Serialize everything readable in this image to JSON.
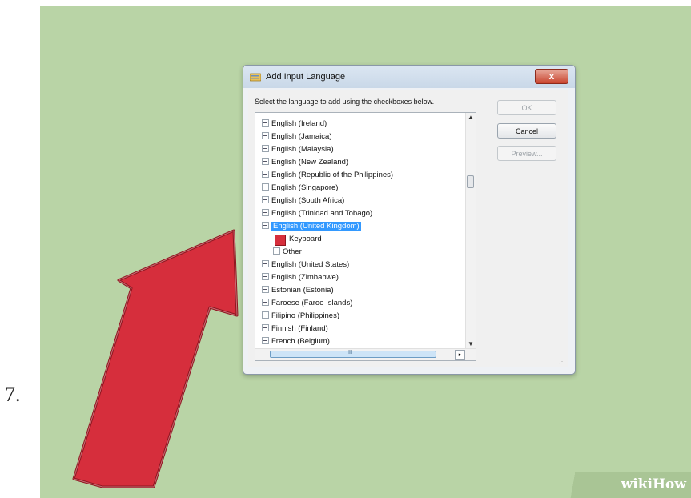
{
  "step_number": "7.",
  "dialog": {
    "title": "Add Input Language",
    "close_symbol": "x",
    "instruction": "Select the language to add using the checkboxes below.",
    "buttons": {
      "ok": "OK",
      "cancel": "Cancel",
      "preview": "Preview..."
    },
    "tree_items": [
      "English (Ireland)",
      "English (Jamaica)",
      "English (Malaysia)",
      "English (New Zealand)",
      "English (Republic of the Philippines)",
      "English (Singapore)",
      "English (South Africa)",
      "English (Trinidad and Tobago)",
      "English (United Kingdom)",
      "Keyboard",
      "Other",
      "English (United States)",
      "English (Zimbabwe)",
      "Estonian (Estonia)",
      "Faroese (Faroe Islands)",
      "Filipino (Philippines)",
      "Finnish (Finland)",
      "French (Belgium)"
    ],
    "selected_item": "English (United Kingdom)",
    "scroll_up": "▲",
    "scroll_down": "▼",
    "hscroll_grip": "III",
    "scroll_right": "▸"
  },
  "watermark": {
    "part1": "wiki",
    "part2": "How"
  },
  "colors": {
    "background": "#b9d4a6",
    "selection": "#3399ff",
    "arrow": "#d62e3c"
  }
}
